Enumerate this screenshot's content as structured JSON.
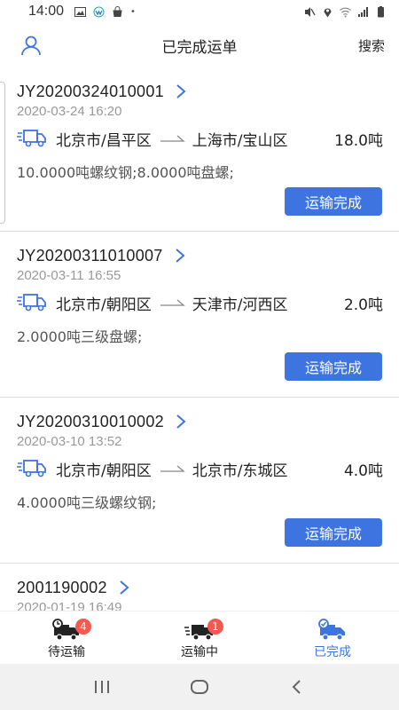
{
  "status_bar": {
    "time": "14:00"
  },
  "header": {
    "title": "已完成运单",
    "search_label": "搜索"
  },
  "orders": [
    {
      "order_no": "JY20200324010001",
      "datetime": "2020-03-24 16:20",
      "from": "北京市/昌平区",
      "to": "上海市/宝山区",
      "weight": "18.0吨",
      "goods": "10.0000吨螺纹钢;8.0000吨盘螺;",
      "status_button": "运输完成"
    },
    {
      "order_no": "JY20200311010007",
      "datetime": "2020-03-11 16:55",
      "from": "北京市/朝阳区",
      "to": "天津市/河西区",
      "weight": "2.0吨",
      "goods": "2.0000吨三级盘螺;",
      "status_button": "运输完成"
    },
    {
      "order_no": "JY20200310010002",
      "datetime": "2020-03-10 13:52",
      "from": "北京市/朝阳区",
      "to": "北京市/东城区",
      "weight": "4.0吨",
      "goods": "4.0000吨三级螺纹钢;",
      "status_button": "运输完成"
    },
    {
      "order_no": "2001190002",
      "datetime": "2020-01-19 16:49"
    }
  ],
  "tabs": [
    {
      "label": "待运输",
      "badge": "4",
      "icon": "truck-waiting-icon"
    },
    {
      "label": "运输中",
      "badge": "1",
      "icon": "truck-moving-icon"
    },
    {
      "label": "已完成",
      "badge": "",
      "icon": "truck-done-icon",
      "active": true
    }
  ],
  "colors": {
    "accent": "#3e74e0",
    "badge": "#f05a50",
    "muted": "#999999"
  }
}
